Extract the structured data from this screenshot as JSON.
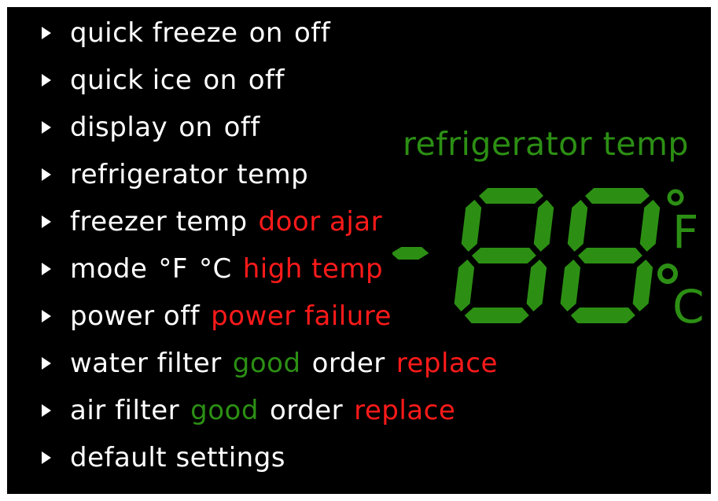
{
  "menu": {
    "items": [
      {
        "segments": [
          {
            "text": "quick freeze",
            "tone": "white"
          },
          {
            "text": "on",
            "tone": "white"
          },
          {
            "text": "off",
            "tone": "white"
          }
        ]
      },
      {
        "segments": [
          {
            "text": "quick ice",
            "tone": "white"
          },
          {
            "text": "on",
            "tone": "white"
          },
          {
            "text": "off",
            "tone": "white"
          }
        ]
      },
      {
        "segments": [
          {
            "text": "display",
            "tone": "white"
          },
          {
            "text": "on",
            "tone": "white"
          },
          {
            "text": "off",
            "tone": "white"
          }
        ]
      },
      {
        "segments": [
          {
            "text": "refrigerator temp",
            "tone": "white"
          }
        ]
      },
      {
        "segments": [
          {
            "text": "freezer temp",
            "tone": "white"
          },
          {
            "text": "door ajar",
            "tone": "red"
          }
        ]
      },
      {
        "segments": [
          {
            "text": "mode",
            "tone": "white"
          },
          {
            "text": "°F",
            "tone": "white"
          },
          {
            "text": "°C",
            "tone": "white"
          },
          {
            "text": "high temp",
            "tone": "red"
          }
        ]
      },
      {
        "segments": [
          {
            "text": "power off",
            "tone": "white"
          },
          {
            "text": "power failure",
            "tone": "red"
          }
        ]
      },
      {
        "segments": [
          {
            "text": "water filter",
            "tone": "white"
          },
          {
            "text": "good",
            "tone": "green"
          },
          {
            "text": "order",
            "tone": "white"
          },
          {
            "text": "replace",
            "tone": "red"
          }
        ]
      },
      {
        "segments": [
          {
            "text": "air filter",
            "tone": "white"
          },
          {
            "text": "good",
            "tone": "green"
          },
          {
            "text": "order",
            "tone": "white"
          },
          {
            "text": "replace",
            "tone": "red"
          }
        ]
      },
      {
        "segments": [
          {
            "text": "default settings",
            "tone": "white"
          }
        ]
      }
    ]
  },
  "display": {
    "title": "refrigerator temp",
    "readout": "-88",
    "unit_f": "F",
    "unit_c": "C"
  },
  "colors": {
    "background": "#000000",
    "text": "#ffffff",
    "alert": "#ff1a1a",
    "lcd": "#2c8f14"
  },
  "icons": {
    "menu_marker": "triangle-right-icon",
    "degree": "degree-icon"
  }
}
